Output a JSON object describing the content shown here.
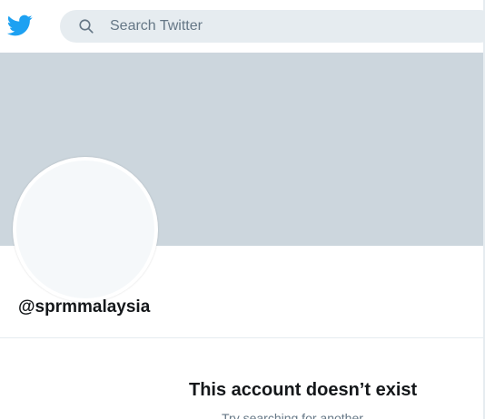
{
  "header": {
    "logo_icon": "twitter-bird-icon",
    "brand_color": "#1da1f2",
    "search": {
      "icon": "search-icon",
      "placeholder": "Search Twitter",
      "value": ""
    }
  },
  "profile": {
    "banner_color": "#ccd6dd",
    "avatar_color": "#f5f8fa",
    "handle": "@sprmmalaysia"
  },
  "empty_state": {
    "title": "This account doesn’t exist",
    "subtitle": "Try searching for another."
  }
}
